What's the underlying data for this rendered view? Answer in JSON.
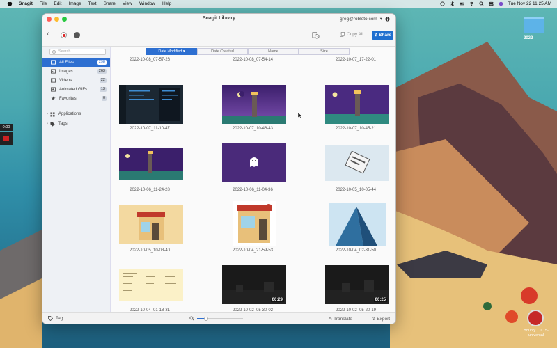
{
  "menubar": {
    "app": "Snagit",
    "items": [
      "File",
      "Edit",
      "Image",
      "Text",
      "Share",
      "View",
      "Window",
      "Help"
    ],
    "clock": "Tue Nov 22  11:25 AM"
  },
  "desktop": {
    "folder_label": "2022",
    "app_label": "Bounty 1.0.15-universal",
    "side_timer": "0:00"
  },
  "window": {
    "title": "Snagit Library",
    "account": "greg@robleto.com",
    "copy_all": "Copy All",
    "share": "Share"
  },
  "sidebar": {
    "search_placeholder": "Search",
    "items": [
      {
        "label": "All Files",
        "count": "298",
        "icon": "all-files-icon"
      },
      {
        "label": "Images",
        "count": "263",
        "icon": "image-icon"
      },
      {
        "label": "Videos",
        "count": "22",
        "icon": "video-icon"
      },
      {
        "label": "Animated GIFs",
        "count": "13",
        "icon": "gif-icon"
      },
      {
        "label": "Favorites",
        "count": "0",
        "icon": "star-icon"
      }
    ],
    "tree": [
      {
        "label": "Applications",
        "icon": "applications-icon"
      },
      {
        "label": "Tags",
        "icon": "tag-icon"
      }
    ]
  },
  "sort": {
    "columns": [
      "Date Modified",
      "Date Created",
      "Name",
      "Size"
    ],
    "active_suffix": "▾"
  },
  "grid": {
    "top_captions": [
      "2022-10-08_07-57-26",
      "2022-10-08_07-54-14",
      "2022-10-07_17-22-01"
    ],
    "items": [
      {
        "caption": "2022-10-07_11-10-47",
        "kind": "code",
        "duration": ""
      },
      {
        "caption": "2022-10-07_10-46-43",
        "kind": "lighthouse",
        "duration": ""
      },
      {
        "caption": "2022-10-07_10-45-21",
        "kind": "lighthouse-wide",
        "duration": ""
      },
      {
        "caption": "2022-10-06_11-24-28",
        "kind": "lighthouse-banner",
        "duration": ""
      },
      {
        "caption": "2022-10-06_11-04-36",
        "kind": "ghost",
        "duration": ""
      },
      {
        "caption": "2022-10-05_10-05-44",
        "kind": "ticket",
        "duration": ""
      },
      {
        "caption": "2022-10-05_10-03-40",
        "kind": "butcher-wide",
        "duration": ""
      },
      {
        "caption": "2022-10-04_21-59-53",
        "kind": "butcher-tall",
        "duration": ""
      },
      {
        "caption": "2022-10-04_02-31-50",
        "kind": "building",
        "duration": ""
      },
      {
        "caption": "2022-10-04_01-18-31",
        "kind": "list",
        "duration": ""
      },
      {
        "caption": "2022-10-02_05-30-02",
        "kind": "video",
        "duration": "00:29"
      },
      {
        "caption": "2022-10-02_05-20-19",
        "kind": "video",
        "duration": "00:25"
      }
    ]
  },
  "footer": {
    "tag": "Tag",
    "translate": "Translate",
    "export": "Export",
    "zoom_level": 0.2
  }
}
